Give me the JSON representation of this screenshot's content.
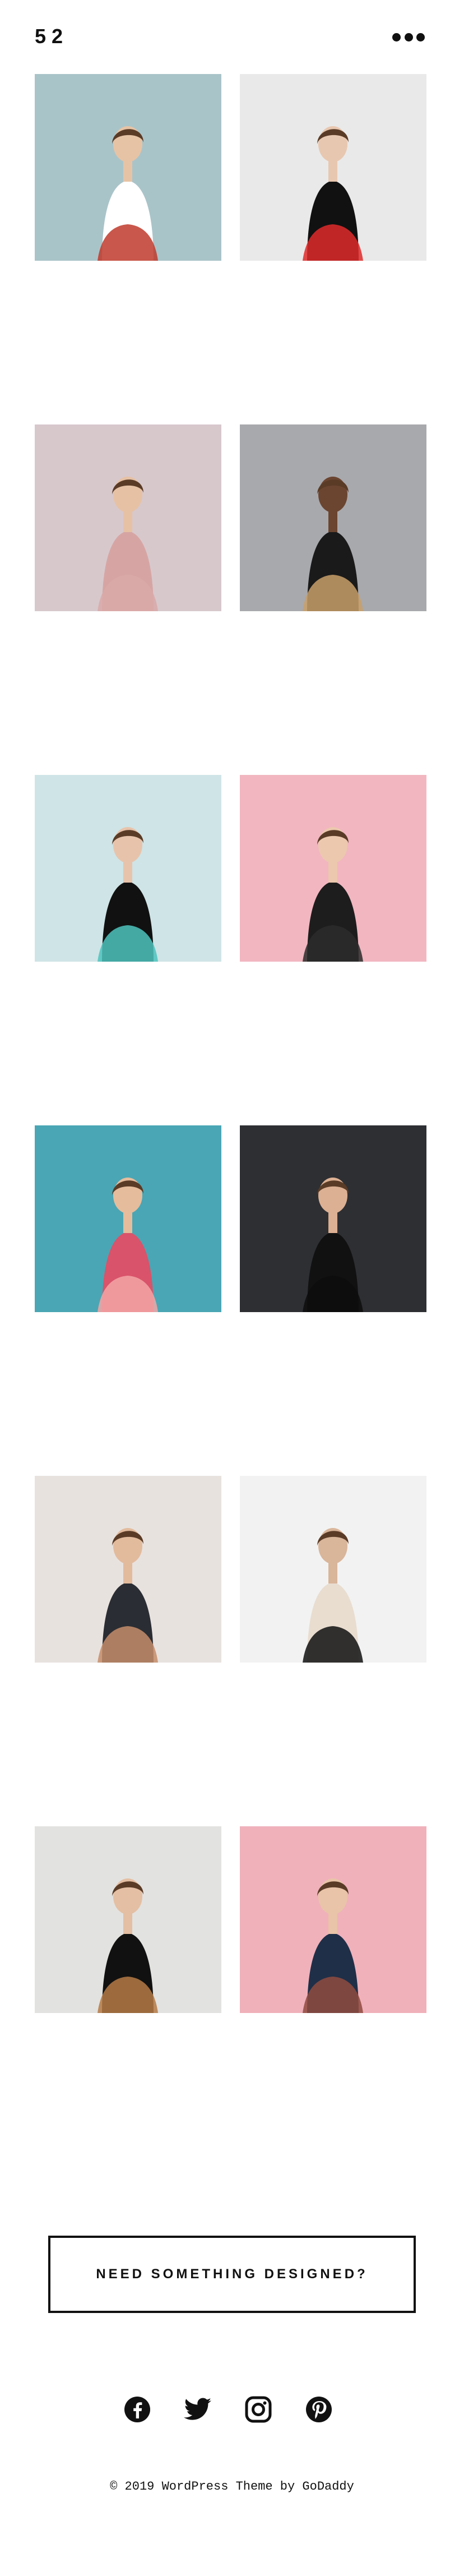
{
  "site": {
    "logo_text": "52"
  },
  "header": {
    "menu_icon": "more-horizontal-icon"
  },
  "gallery": {
    "items": [
      {
        "name": "woman-red-hat-lace-blouse",
        "bg": "#a9c4c9",
        "accent": "#c0392b",
        "top": "#ffffff",
        "skin": "#e6c3a5"
      },
      {
        "name": "striped-dress-red-handbag",
        "bg": "#e9e9e9",
        "accent": "#e02a2a",
        "top": "#111111",
        "skin": "#e8c7b0"
      },
      {
        "name": "woman-pink-top-portrait",
        "bg": "#d7c8cc",
        "accent": "#d9a9a9",
        "top": "#d6a5a3",
        "skin": "#e6c1a4"
      },
      {
        "name": "woman-polka-dot-outfit-gray",
        "bg": "#a8a9ad",
        "accent": "#c9a06a",
        "top": "#1a1a1a",
        "skin": "#6b4530"
      },
      {
        "name": "woman-teal-sun-hat",
        "bg": "#cfe4e6",
        "accent": "#4ec3bd",
        "top": "#111111",
        "skin": "#e7c3ab"
      },
      {
        "name": "woman-headphones-pink",
        "bg": "#f2b6c0",
        "accent": "#2b2b2b",
        "top": "#1d1d1d",
        "skin": "#ecc8ae"
      },
      {
        "name": "woman-floral-dress-teal",
        "bg": "#4aa6b4",
        "accent": "#f2a6a6",
        "top": "#d9536a",
        "skin": "#e5bc9c"
      },
      {
        "name": "woman-black-lace-dress",
        "bg": "#2e2f33",
        "accent": "#0d0d0d",
        "top": "#111111",
        "skin": "#dcb093"
      },
      {
        "name": "woman-headscarf-long-skirt",
        "bg": "#e8e2df",
        "accent": "#c58d6b",
        "top": "#2a2d33",
        "skin": "#e2bb9d"
      },
      {
        "name": "black-leather-handbag",
        "bg": "#f2f2f2",
        "accent": "#111111",
        "top": "#e9ddd0",
        "skin": "#d9b59a"
      },
      {
        "name": "woman-camel-jacket-hat",
        "bg": "#e2e2e0",
        "accent": "#b57a45",
        "top": "#111111",
        "skin": "#e4bfa3"
      },
      {
        "name": "woman-leopard-top-pink",
        "bg": "#f0b1bb",
        "accent": "#8f4b3f",
        "top": "#1f2f48",
        "skin": "#e9c4a8"
      }
    ]
  },
  "cta": {
    "label": "NEED SOMETHING DESIGNED?"
  },
  "social": {
    "links": [
      {
        "name": "facebook-icon"
      },
      {
        "name": "twitter-icon"
      },
      {
        "name": "instagram-icon"
      },
      {
        "name": "pinterest-icon"
      }
    ]
  },
  "footer": {
    "text": "© 2019  WordPress Theme by GoDaddy"
  }
}
